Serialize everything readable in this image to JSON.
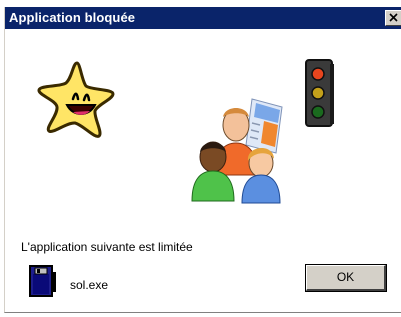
{
  "window": {
    "title": "Application bloquée"
  },
  "dialog": {
    "message": "L'application suivante est limitée",
    "file_name": "sol.exe",
    "ok_label": "OK"
  },
  "icons": {
    "mascot": "smiling-star-icon",
    "traffic_light": "traffic-light-icon",
    "users": "users-group-icon",
    "file": "executable-file-icon",
    "close": "close-icon"
  },
  "colors": {
    "titlebar": "#0a246a",
    "button_face": "#d4d0c8",
    "star": "#ffe566"
  }
}
